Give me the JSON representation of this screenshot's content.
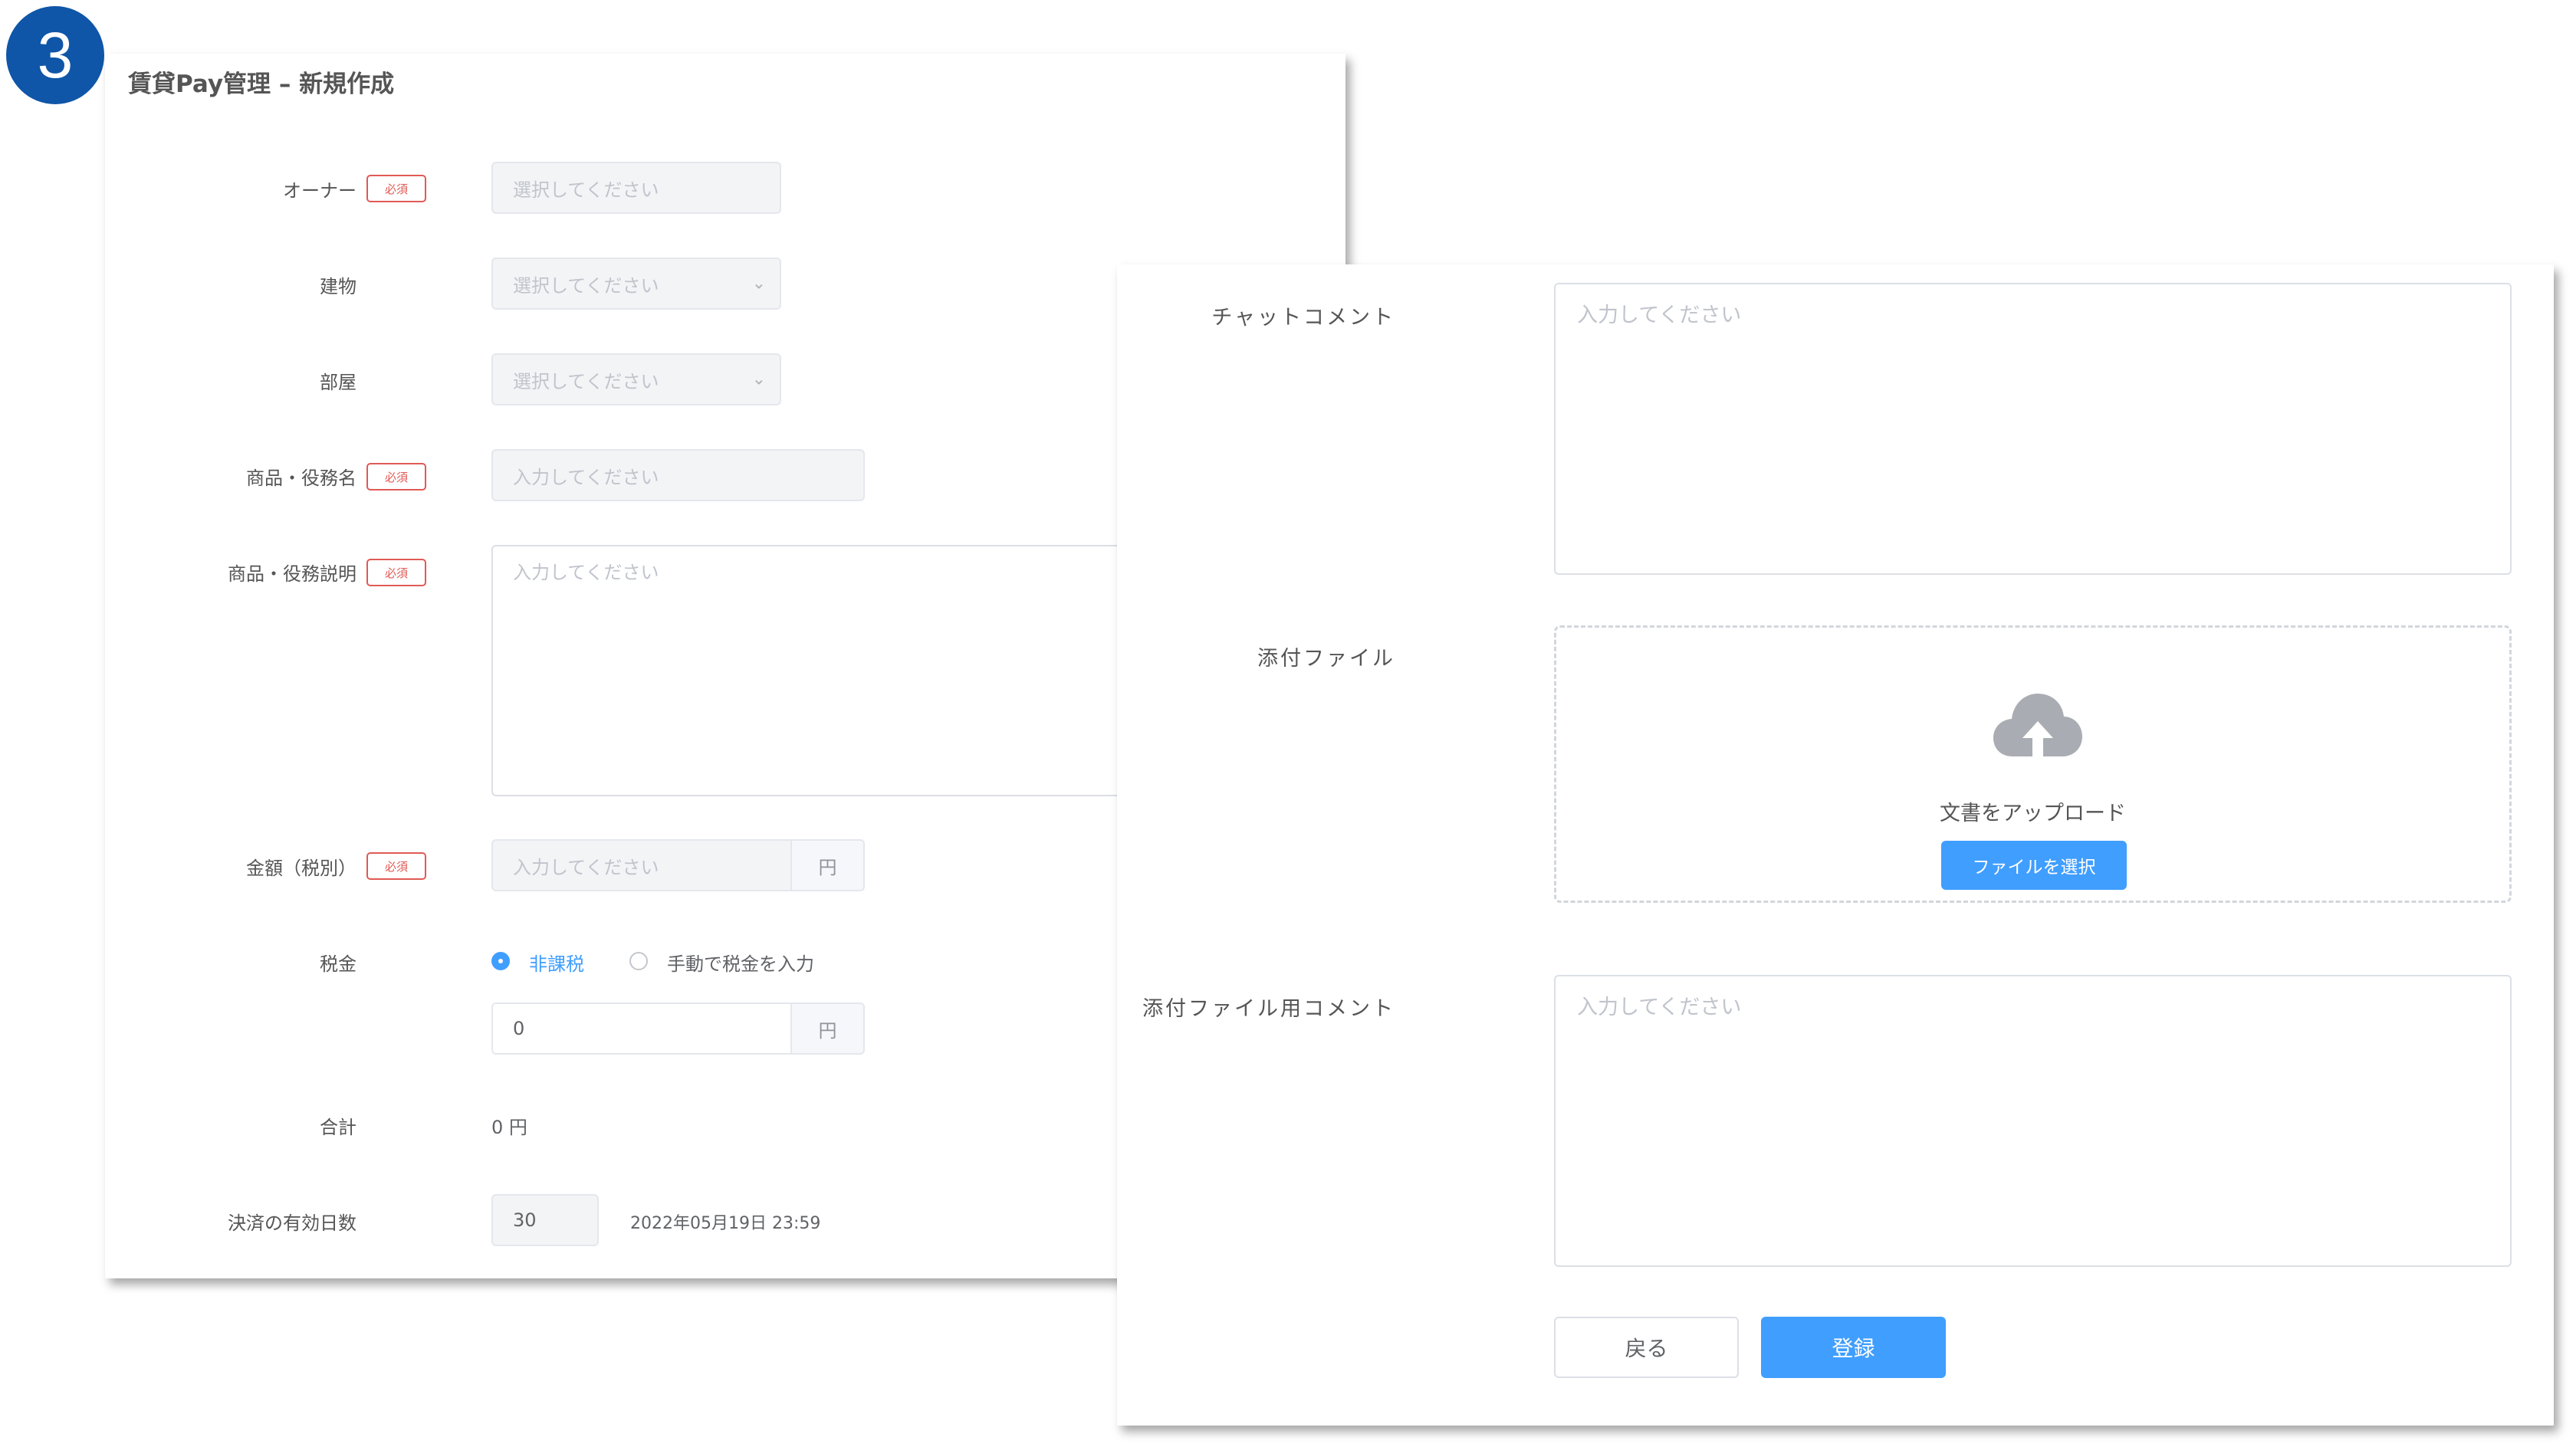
{
  "step_number": "3",
  "page_title": "賃貸Pay管理 – 新規作成",
  "required_label": "必須",
  "colors": {
    "accent": "#409eff",
    "required": "#e05a55",
    "badge": "#0f56a8"
  },
  "form": {
    "owner": {
      "label": "オーナー",
      "placeholder": "選択してください"
    },
    "building": {
      "label": "建物",
      "placeholder": "選択してください"
    },
    "room": {
      "label": "部屋",
      "placeholder": "選択してください"
    },
    "product_name": {
      "label": "商品・役務名",
      "placeholder": "入力してください"
    },
    "product_desc": {
      "label": "商品・役務説明",
      "placeholder": "入力してください"
    },
    "amount": {
      "label": "金額（税別）",
      "placeholder": "入力してください",
      "unit": "円"
    },
    "tax": {
      "label": "税金",
      "options": [
        "非課税",
        "手動で税金を入力"
      ],
      "selected": "非課税",
      "value": "0",
      "unit": "円"
    },
    "total": {
      "label": "合計",
      "value": "0 円"
    },
    "payment_days": {
      "label": "決済の有効日数",
      "value": "30",
      "deadline": "2022年05月19日 23:59"
    },
    "chat_comment": {
      "label": "チャットコメント",
      "placeholder": "入力してください"
    },
    "attachment": {
      "label": "添付ファイル",
      "icon": "cloud-upload-icon",
      "upload_text": "文書をアップロード",
      "button": "ファイルを選択"
    },
    "attachment_comment": {
      "label": "添付ファイル用コメント",
      "placeholder": "入力してください"
    }
  },
  "actions": {
    "back": "戻る",
    "submit": "登録"
  }
}
